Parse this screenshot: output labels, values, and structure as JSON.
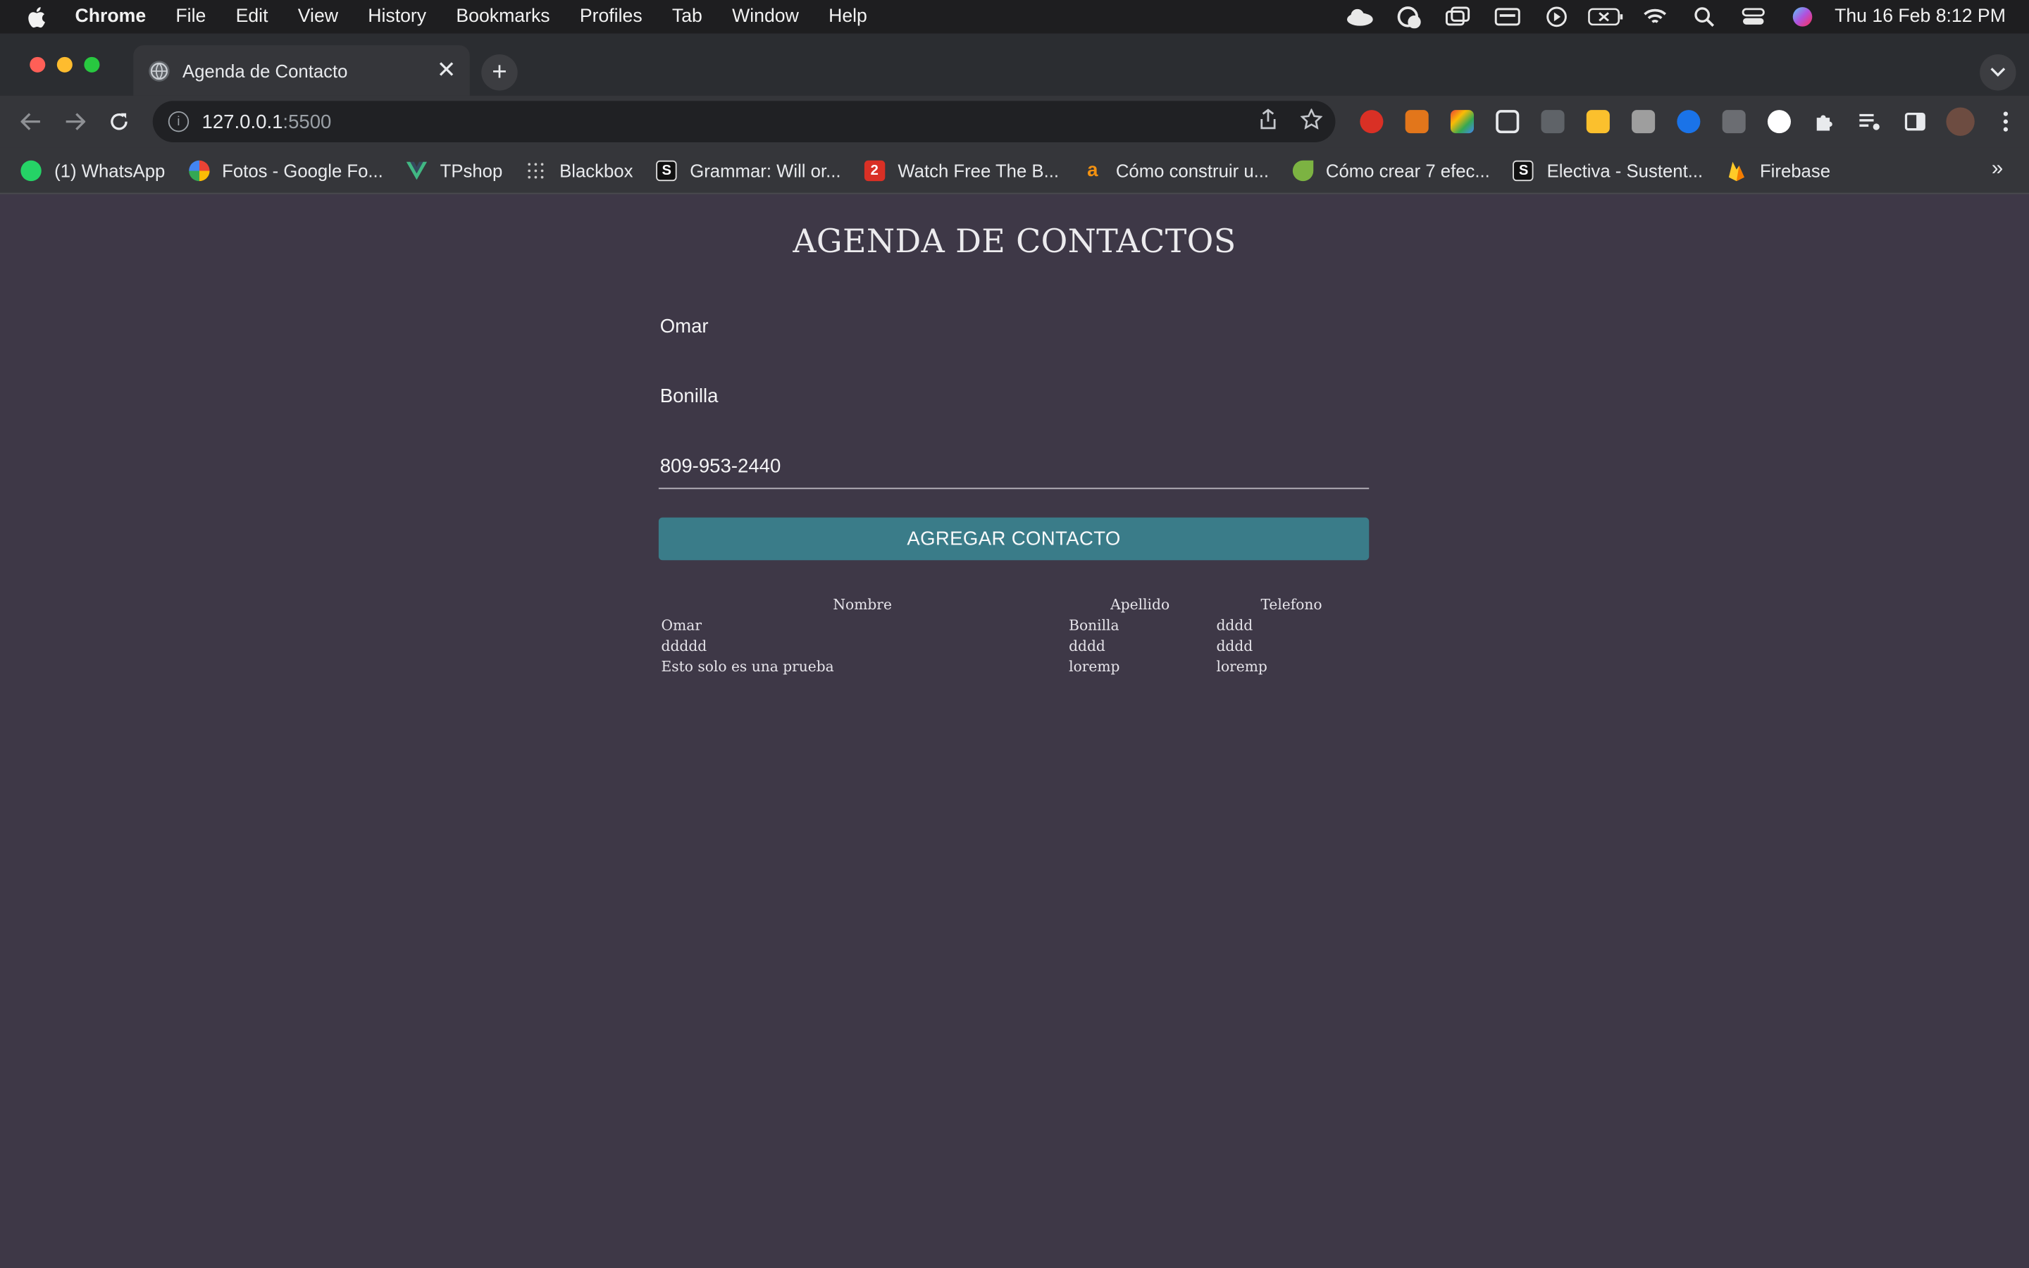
{
  "menubar": {
    "app_name": "Chrome",
    "items": [
      "File",
      "Edit",
      "View",
      "History",
      "Bookmarks",
      "Profiles",
      "Tab",
      "Window",
      "Help"
    ],
    "clock": "Thu 16 Feb  8:12 PM"
  },
  "tab": {
    "title": "Agenda de Contacto",
    "close_glyph": "✕",
    "new_tab_glyph": "+"
  },
  "omnibox": {
    "host": "127.0.0.1",
    "port": ":5500"
  },
  "bookmarks": [
    {
      "label": "(1) WhatsApp",
      "icon": "whatsapp-icon",
      "color": "#25d366",
      "glyph": ""
    },
    {
      "label": "Fotos - Google Fo...",
      "icon": "google-photos-icon",
      "color": "#ea4335",
      "glyph": ""
    },
    {
      "label": "TPshop",
      "icon": "vue-icon",
      "color": "#41b883",
      "glyph": ""
    },
    {
      "label": "Blackbox",
      "icon": "blackbox-icon",
      "color": "#555555",
      "glyph": ""
    },
    {
      "label": "Grammar: Will or...",
      "icon": "grammar-icon",
      "color": "#111111",
      "glyph": "S"
    },
    {
      "label": "Watch Free The B...",
      "icon": "watch-icon",
      "color": "#d93025",
      "glyph": "2"
    },
    {
      "label": "Cómo construir u...",
      "icon": "amazon-icon",
      "color": "#f29111",
      "glyph": "a"
    },
    {
      "label": "Cómo crear 7 efec...",
      "icon": "leaf-icon",
      "color": "#7cb342",
      "glyph": ""
    },
    {
      "label": "Electiva - Sustent...",
      "icon": "electiva-icon",
      "color": "#111111",
      "glyph": "S"
    },
    {
      "label": "Firebase",
      "icon": "firebase-icon",
      "color": "#ffca28",
      "glyph": ""
    }
  ],
  "bookmarks_more": "»",
  "page": {
    "heading": "AGENDA DE CONTACTOS",
    "first_name_value": "Omar",
    "last_name_value": "Bonilla",
    "phone_value": "809-953-2440",
    "add_button": "AGREGAR CONTACTO",
    "table": {
      "headers": [
        "Nombre",
        "Apellido",
        "Telefono"
      ],
      "rows": [
        [
          "Omar",
          "Bonilla",
          "dddd"
        ],
        [
          "ddddd",
          "dddd",
          "dddd"
        ],
        [
          "Esto solo es una prueba",
          "loremp",
          "loremp"
        ]
      ]
    }
  },
  "colors": {
    "page_bg": "#3e3847",
    "button_bg": "#3a7c89",
    "text": "#f4f4f6"
  }
}
